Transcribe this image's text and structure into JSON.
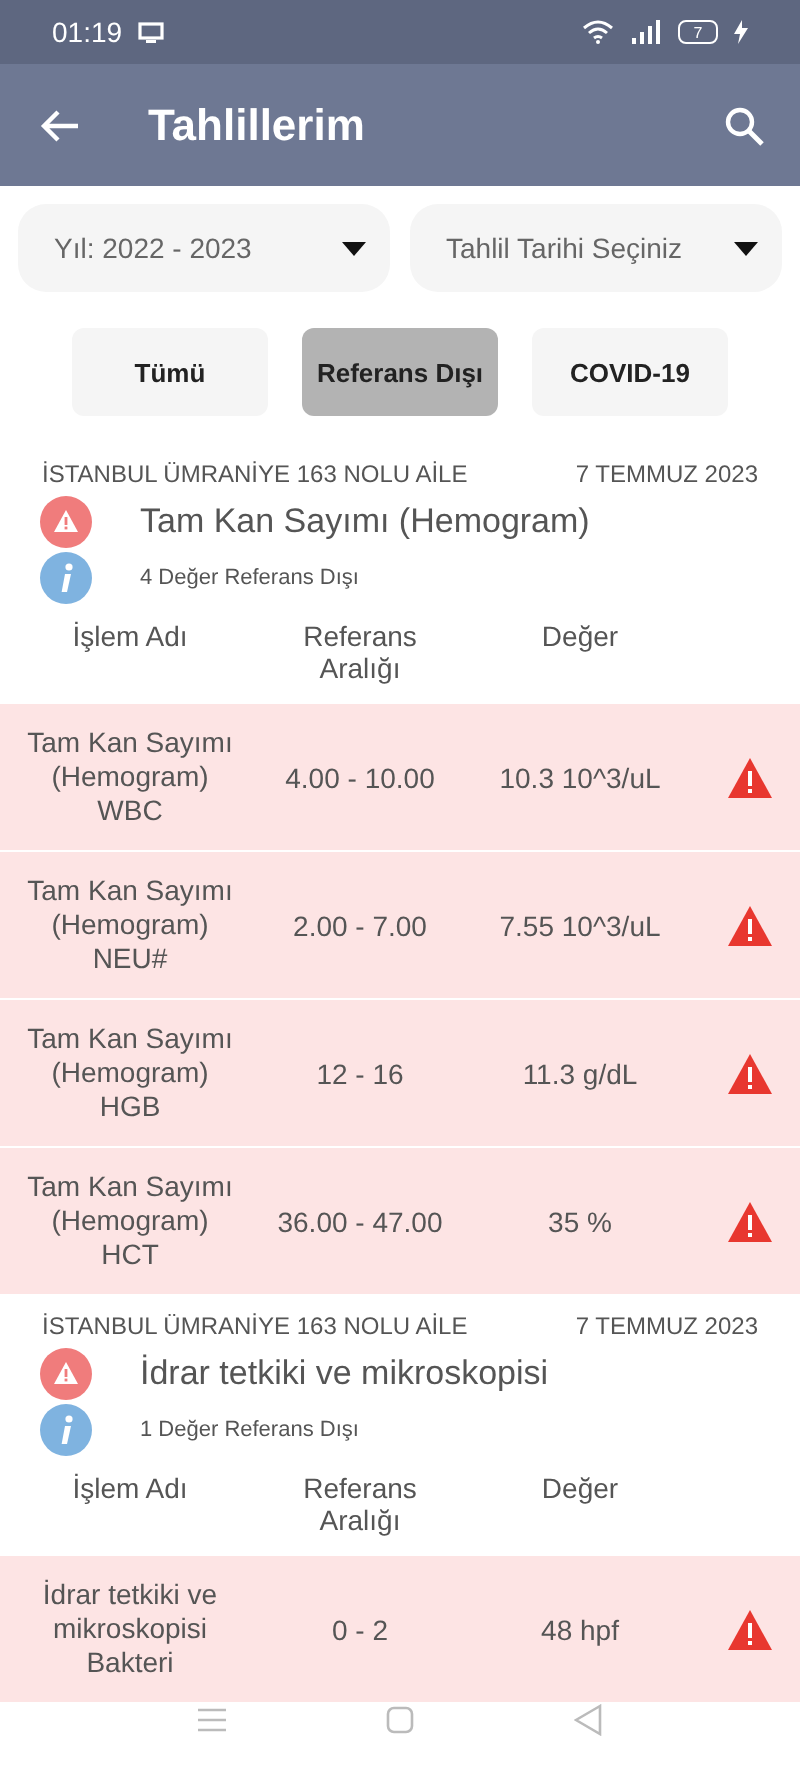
{
  "status_bar": {
    "time": "01:19",
    "battery": "7"
  },
  "app_bar": {
    "title": "Tahlillerim"
  },
  "filters": [
    {
      "label": "Yıl: 2022 - 2023"
    },
    {
      "label": "Tahlil Tarihi Seçiniz"
    }
  ],
  "tabs": [
    {
      "label": "Tümü",
      "selected": false
    },
    {
      "label": "Referans Dışı",
      "selected": true
    },
    {
      "label": "COVID-19",
      "selected": false
    }
  ],
  "groups": [
    {
      "facility": "İSTANBUL ÜMRANİYE 163 NOLU AİLE",
      "date": "7 TEMMUZ 2023",
      "test": "Tam Kan Sayımı (Hemogram)",
      "summary": "4 Değer Referans Dışı",
      "columns": [
        "İşlem Adı",
        "Referans Aralığı",
        "Değer"
      ],
      "rows": [
        {
          "name": "Tam Kan Sayımı (Hemogram) WBC",
          "range": "4.00 - 10.00",
          "value": "10.3 10^3/uL",
          "out_of_range": true
        },
        {
          "name": "Tam Kan Sayımı (Hemogram) NEU#",
          "range": "2.00 - 7.00",
          "value": "7.55 10^3/uL",
          "out_of_range": true
        },
        {
          "name": "Tam Kan Sayımı (Hemogram) HGB",
          "range": "12 - 16",
          "value": "11.3 g/dL",
          "out_of_range": true
        },
        {
          "name": "Tam Kan Sayımı (Hemogram) HCT",
          "range": "36.00 - 47.00",
          "value": "35 %",
          "out_of_range": true
        }
      ]
    },
    {
      "facility": "İSTANBUL ÜMRANİYE 163 NOLU AİLE",
      "date": "7 TEMMUZ 2023",
      "test": "İdrar tetkiki ve mikroskopisi",
      "summary": "1 Değer Referans Dışı",
      "columns": [
        "İşlem Adı",
        "Referans Aralığı",
        "Değer"
      ],
      "rows": [
        {
          "name": "İdrar tetkiki ve mikroskopisi Bakteri",
          "range": "0 - 2",
          "value": "48 hpf",
          "out_of_range": true
        }
      ]
    }
  ]
}
